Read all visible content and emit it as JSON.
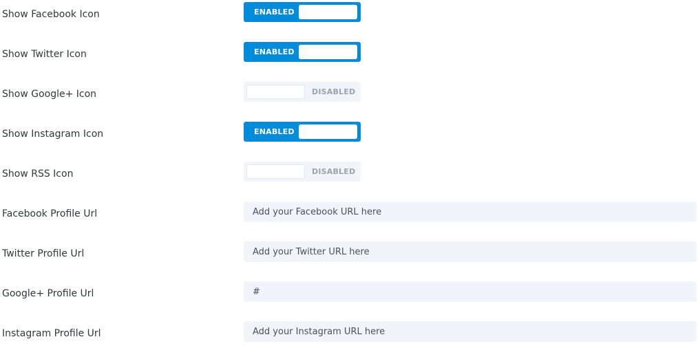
{
  "toggles": [
    {
      "label": "Show Facebook Icon",
      "state": "ENABLED",
      "enabled": true
    },
    {
      "label": "Show Twitter Icon",
      "state": "ENABLED",
      "enabled": true
    },
    {
      "label": "Show Google+ Icon",
      "state": "DISABLED",
      "enabled": false
    },
    {
      "label": "Show Instagram Icon",
      "state": "ENABLED",
      "enabled": true
    },
    {
      "label": "Show RSS Icon",
      "state": "DISABLED",
      "enabled": false
    }
  ],
  "fields": [
    {
      "label": "Facebook Profile Url",
      "value": "",
      "placeholder": "Add your Facebook URL here"
    },
    {
      "label": "Twitter Profile Url",
      "value": "",
      "placeholder": "Add your Twitter URL here"
    },
    {
      "label": "Google+ Profile Url",
      "value": "#",
      "placeholder": ""
    },
    {
      "label": "Instagram Profile Url",
      "value": "",
      "placeholder": "Add your Instagram URL here"
    }
  ],
  "colors": {
    "toggle_on": "#008bdb",
    "toggle_off": "#f1f5f9",
    "input_bg": "#f1f5f9",
    "label_text": "#32373c"
  }
}
